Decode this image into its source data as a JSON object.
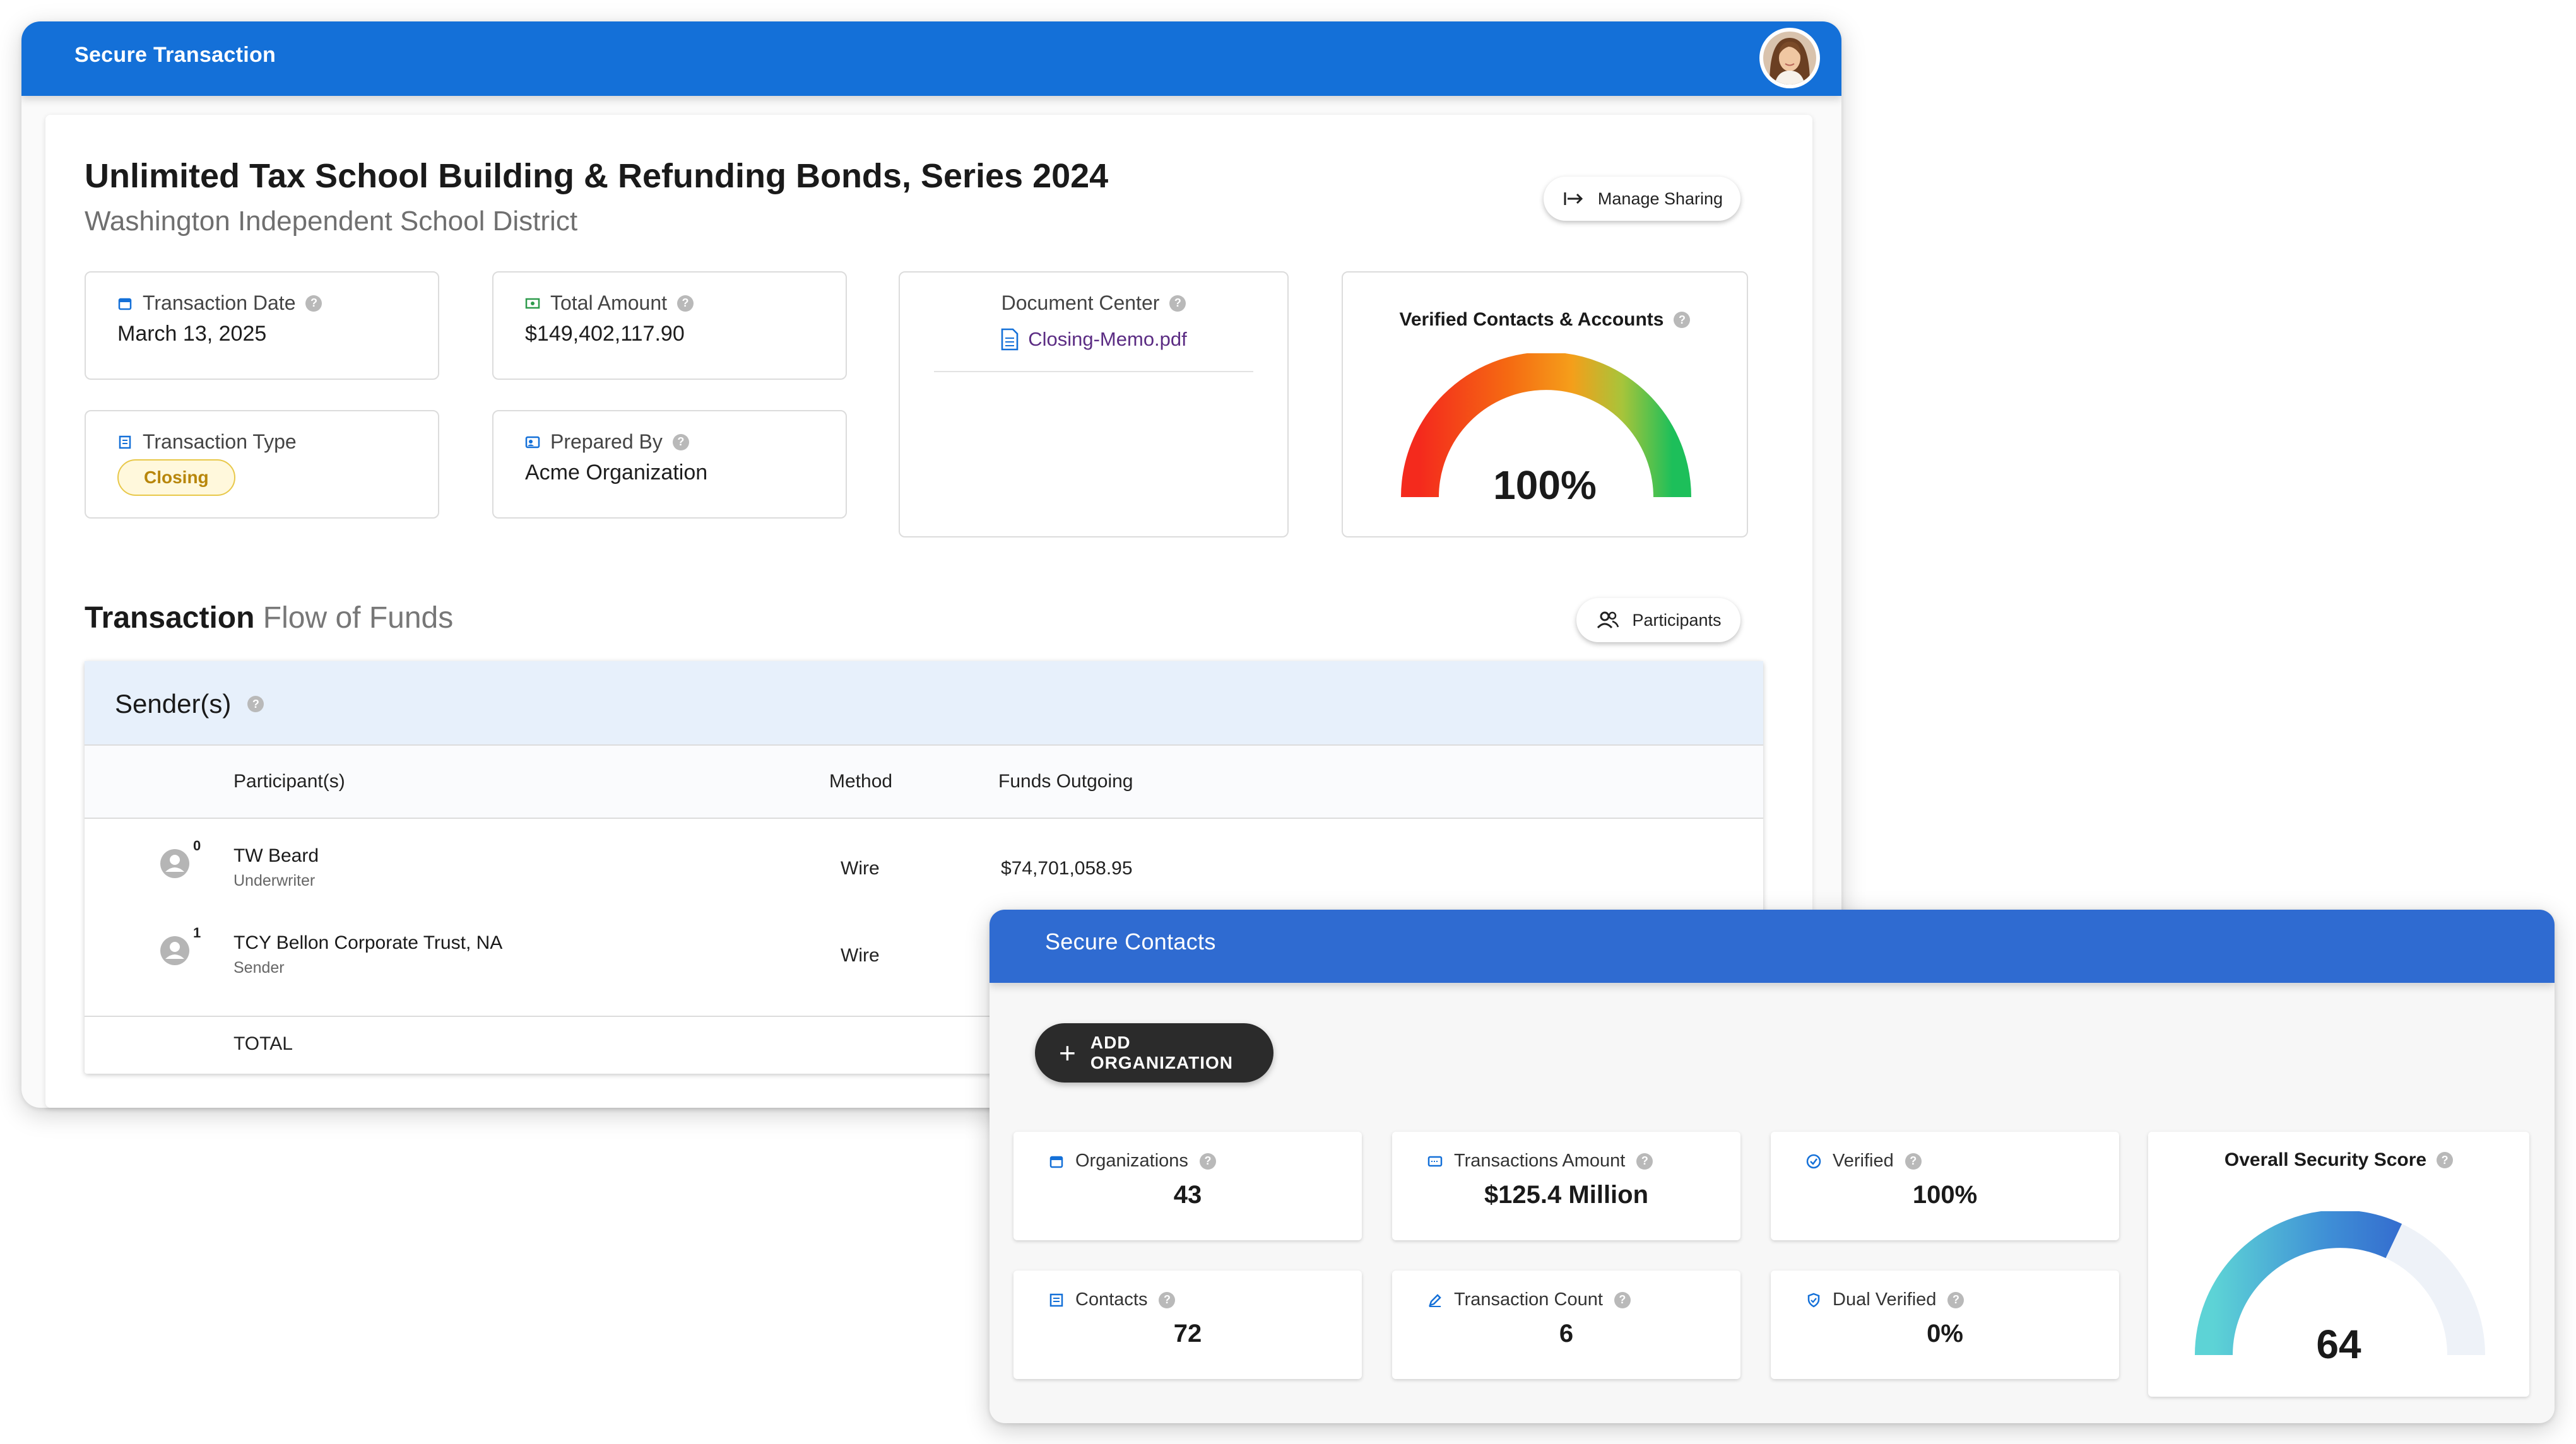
{
  "window1": {
    "title": "Secure Transaction",
    "heading": "Unlimited Tax School Building & Refunding Bonds, Series 2024",
    "subheading": "Washington Independent School District",
    "manage_sharing": "Manage Sharing",
    "fields": {
      "transaction_date": {
        "label": "Transaction Date",
        "value": "March 13, 2025"
      },
      "total_amount": {
        "label": "Total Amount",
        "value": "$149,402,117.90"
      },
      "transaction_type": {
        "label": "Transaction Type",
        "value": "Closing"
      },
      "prepared_by": {
        "label": "Prepared By",
        "value": "Acme Organization"
      }
    },
    "document_center": {
      "label": "Document Center",
      "file": "Closing-Memo.pdf"
    },
    "verified": {
      "label": "Verified Contacts & Accounts",
      "value": "100%",
      "level": 1.0
    },
    "flow": {
      "bold": "Transaction",
      "light": "Flow of Funds",
      "participants_button": "Participants"
    },
    "senders": {
      "section_title": "Sender(s)",
      "columns": [
        "Participant(s)",
        "Method",
        "Funds Outgoing"
      ],
      "rows": [
        {
          "index": "0",
          "name": "TW Beard",
          "role": "Underwriter",
          "method": "Wire",
          "funds": "$74,701,058.95"
        },
        {
          "index": "1",
          "name": "TCY Bellon Corporate Trust, NA",
          "role": "Sender",
          "method": "Wire",
          "funds": ""
        }
      ],
      "total_label": "TOTAL"
    }
  },
  "window2": {
    "title": "Secure Contacts",
    "add_button": "ADD ORGANIZATION",
    "stats": {
      "organizations": {
        "label": "Organizations",
        "value": "43"
      },
      "transactions_amount": {
        "label": "Transactions Amount",
        "value": "$125.4 Million"
      },
      "verified": {
        "label": "Verified",
        "value": "100%"
      },
      "contacts": {
        "label": "Contacts",
        "value": "72"
      },
      "transaction_count": {
        "label": "Transaction Count",
        "value": "6"
      },
      "dual_verified": {
        "label": "Dual Verified",
        "value": "0%"
      }
    },
    "score": {
      "label": "Overall Security Score",
      "value": "64",
      "level": 0.64
    }
  },
  "help_glyph": "?",
  "colors": {
    "window1_bar": "#1470d8",
    "window2_bar": "#2f6bd1",
    "badge": "#e8c84a"
  }
}
